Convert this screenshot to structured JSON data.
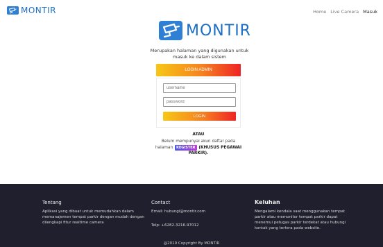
{
  "header": {
    "brand": "MONTIR",
    "nav": [
      "Home",
      "Live Camera",
      "Masuk"
    ]
  },
  "hero": {
    "logo_text": "MONTIR",
    "subtitle": "Merupakan halaman yang digunakan untuk masuk ke dalam sistem"
  },
  "admin_button": "LOGIN ADMIN",
  "form": {
    "username_placeholder": "username",
    "password_placeholder": "password",
    "login_label": "LOGIN"
  },
  "register": {
    "or_text": "ATAU",
    "before": "Belum mempunyai akun daftar pada halaman",
    "link": "REGISTER",
    "after": "(KHUSUS PEGAWAI PARKIR)."
  },
  "footer": {
    "about_title": "Tentang",
    "about_text": "Aplikasi yang dibuat untuk memudahkan dalam memanajemen tempat parkir dengan mudah dengan dilengkapi fitur realtime camera",
    "contact_title": "Contact",
    "email": "Email: hubungi@montir.com",
    "phone": "Telp: +6282-3216-97012",
    "complaint_title": "Keluhan",
    "complaint_text": "Mengalami kendala saat menggunakan tempat parkir atau memonitor tempat parkir dapat menemui petugas parkir terdekat atau hubungi kontak yang tertera pada website.",
    "copyright": "@2019 Copyright By MONTIR"
  },
  "colors": {
    "brand_blue": "#1d6fc4",
    "gradient_start": "#f7c716",
    "gradient_end": "#ee2424",
    "footer_bg": "#1f1f2e"
  },
  "icons": {
    "brand": "cctv-camera-icon"
  }
}
